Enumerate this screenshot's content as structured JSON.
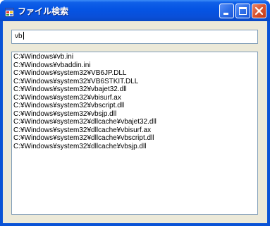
{
  "window": {
    "title": "ファイル検索",
    "accent_color": "#0a53d6"
  },
  "search": {
    "value": "vb"
  },
  "results": [
    "C:¥Windows¥vb.ini",
    "C:¥Windows¥vbaddin.ini",
    "C:¥Windows¥system32¥VB6JP.DLL",
    "C:¥Windows¥system32¥VB6STKIT.DLL",
    "C:¥Windows¥system32¥vbajet32.dll",
    "C:¥Windows¥system32¥vbisurf.ax",
    "C:¥Windows¥system32¥vbscript.dll",
    "C:¥Windows¥system32¥vbsjp.dll",
    "C:¥Windows¥system32¥dllcache¥vbajet32.dll",
    "C:¥Windows¥system32¥dllcache¥vbisurf.ax",
    "C:¥Windows¥system32¥dllcache¥vbscript.dll",
    "C:¥Windows¥system32¥dllcache¥vbsjp.dll"
  ],
  "icons": {
    "app": "app-window-icon",
    "minimize": "minimize-icon",
    "maximize": "maximize-icon",
    "close": "close-icon"
  }
}
